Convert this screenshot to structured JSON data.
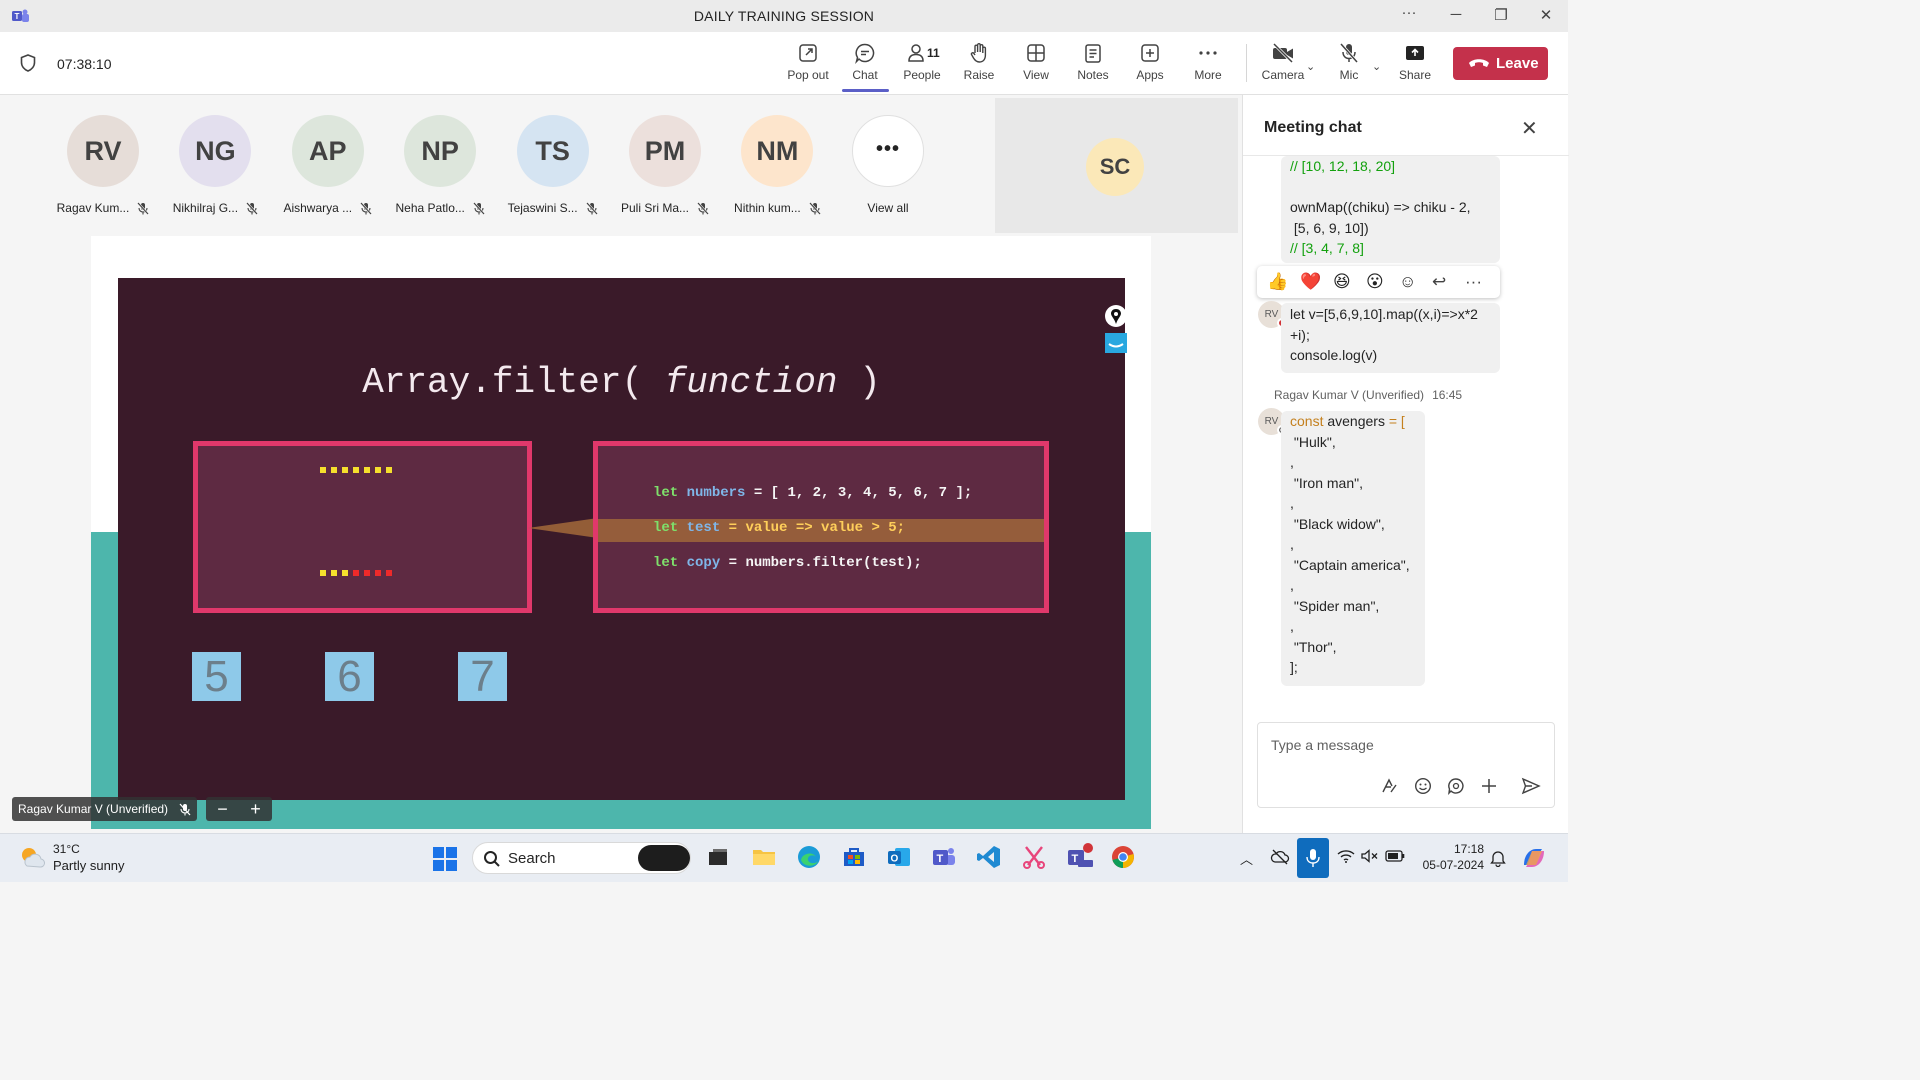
{
  "window": {
    "title": "DAILY TRAINING SESSION"
  },
  "meeting": {
    "timer": "07:38:10",
    "toolbar": {
      "pop_out": "Pop out",
      "chat": "Chat",
      "people": "People",
      "people_count": "11",
      "raise": "Raise",
      "view": "View",
      "notes": "Notes",
      "apps": "Apps",
      "more": "More",
      "camera": "Camera",
      "mic": "Mic",
      "share": "Share",
      "leave": "Leave"
    }
  },
  "participants": [
    {
      "initials": "RV",
      "name": "Ragav Kum...",
      "color": "#e6ddd8"
    },
    {
      "initials": "NG",
      "name": "Nikhilraj G...",
      "color": "#e3dfee"
    },
    {
      "initials": "AP",
      "name": "Aishwarya ...",
      "color": "#dde6dc"
    },
    {
      "initials": "NP",
      "name": "Neha Patlo...",
      "color": "#dde6dc"
    },
    {
      "initials": "TS",
      "name": "Tejaswini S...",
      "color": "#d5e4f2"
    },
    {
      "initials": "PM",
      "name": "Puli Sri Ma...",
      "color": "#ece0dc"
    },
    {
      "initials": "NM",
      "name": "Nithin kum...",
      "color": "#fde5cc"
    }
  ],
  "view_all": {
    "label": "View all",
    "icon": "ellipsis-icon"
  },
  "spotlight": {
    "initials": "SC"
  },
  "slide": {
    "title_prefix": "Array.filter(",
    "title_italic": "function",
    "title_suffix": ")",
    "code": {
      "line1": {
        "let": "let",
        "var": "numbers",
        "rest": " = [ 1, 2, 3, 4, 5, 6, 7 ];"
      },
      "line2": {
        "let": "let",
        "var": "test",
        "rest": " = value => value > 5;"
      },
      "line3": {
        "let": "let",
        "var": "copy",
        "rest": " = numbers.filter(test);"
      }
    },
    "results": [
      "5",
      "6",
      "7"
    ]
  },
  "presenter_tag": "Ragav Kumar V (Unverified)",
  "zoom": {
    "out": "−",
    "in": "+"
  },
  "chat_panel": {
    "title": "Meeting chat",
    "msg1_lines": [
      "// [10, 12, 18, 20]",
      "",
      "ownMap((chiku) => chiku - 2,",
      " [5, 6, 9, 10])",
      "// [3, 4, 7, 8]"
    ],
    "msg2_lines": [
      "let v=[5,6,9,10].map((x,i)=>x*2",
      "+i);",
      "console.log(v)"
    ],
    "sender": "Ragav Kumar V (Unverified)",
    "time": "16:45",
    "avatar": "RV",
    "msg3_lines": [
      {
        "kw": "const",
        "txt": " avengers ",
        "kw2": "= ["
      },
      {
        "txt": " \"Hulk\","
      },
      {
        "txt": ","
      },
      {
        "txt": " \"Iron man\","
      },
      {
        "txt": ","
      },
      {
        "txt": " \"Black widow\","
      },
      {
        "txt": ","
      },
      {
        "txt": " \"Captain america\","
      },
      {
        "txt": ","
      },
      {
        "txt": " \"Spider man\","
      },
      {
        "txt": ","
      },
      {
        "txt": " \"Thor\","
      },
      {
        "txt": "];"
      }
    ],
    "compose_placeholder": "Type a message"
  },
  "taskbar": {
    "temp": "31°C",
    "condition": "Partly sunny",
    "search": "Search",
    "time": "17:18",
    "date": "05-07-2024"
  }
}
